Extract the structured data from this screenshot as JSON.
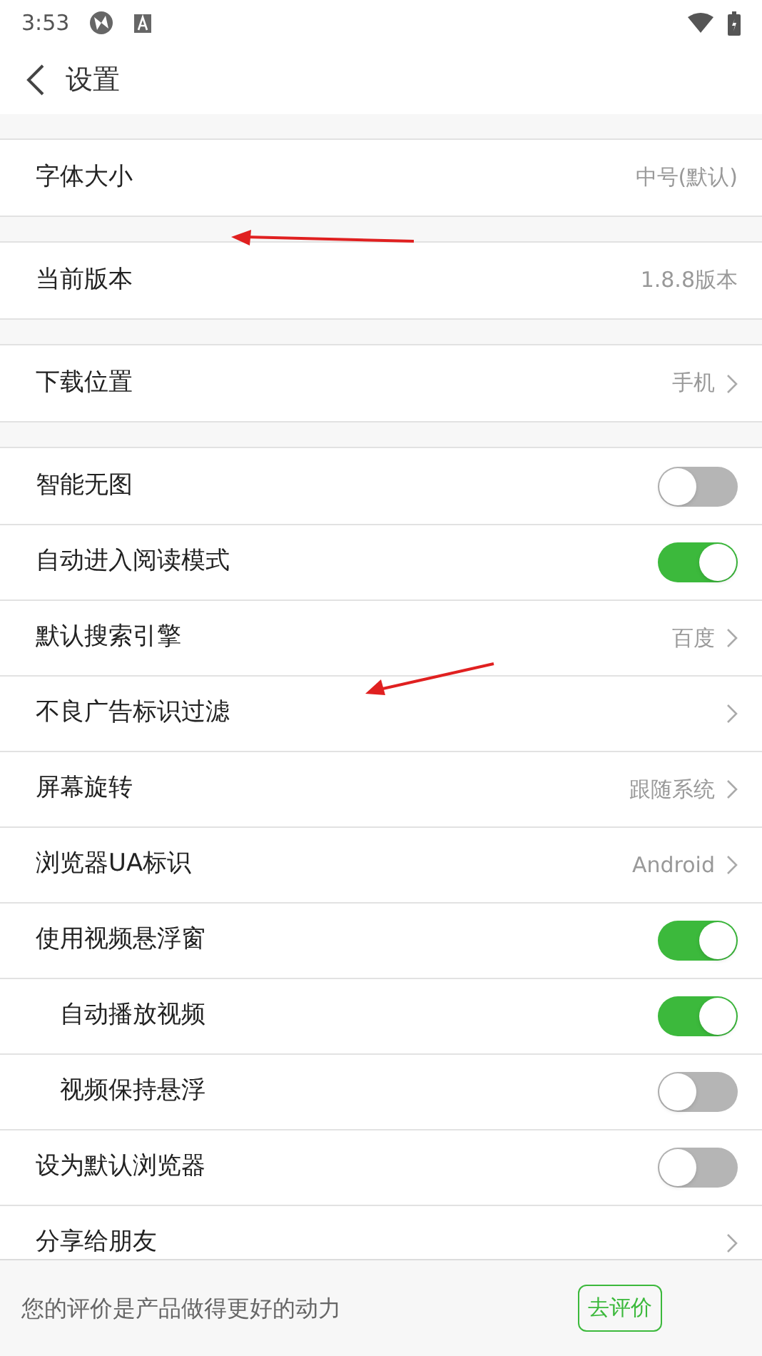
{
  "status_bar": {
    "time": "3:53"
  },
  "header": {
    "title": "设置"
  },
  "sections": [
    {
      "rows": [
        {
          "kind": "value",
          "label": "字体大小",
          "value": "中号(默认)"
        }
      ]
    },
    {
      "rows": [
        {
          "kind": "value",
          "label": "当前版本",
          "value": "1.8.8版本"
        }
      ]
    },
    {
      "rows": [
        {
          "kind": "link",
          "label": "下载位置",
          "value": "手机"
        }
      ]
    },
    {
      "rows": [
        {
          "kind": "toggle",
          "label": "智能无图",
          "on": false
        },
        {
          "kind": "toggle",
          "label": "自动进入阅读模式",
          "on": true
        },
        {
          "kind": "link",
          "label": "默认搜索引擎",
          "value": "百度"
        },
        {
          "kind": "link",
          "label": "不良广告标识过滤"
        },
        {
          "kind": "link",
          "label": "屏幕旋转",
          "value": "跟随系统"
        },
        {
          "kind": "link",
          "label": "浏览器UA标识",
          "value": "Android"
        },
        {
          "kind": "toggle",
          "label": "使用视频悬浮窗",
          "on": true,
          "children": [
            {
              "kind": "toggle",
              "label": "自动播放视频",
              "on": true
            },
            {
              "kind": "toggle",
              "label": "视频保持悬浮",
              "on": false
            }
          ]
        },
        {
          "kind": "toggle",
          "label": "设为默认浏览器",
          "on": false
        },
        {
          "kind": "link",
          "label": "分享给朋友"
        }
      ]
    }
  ],
  "rating_bar": {
    "text": "您的评价是产品做得更好的动力",
    "button": "去评价"
  }
}
